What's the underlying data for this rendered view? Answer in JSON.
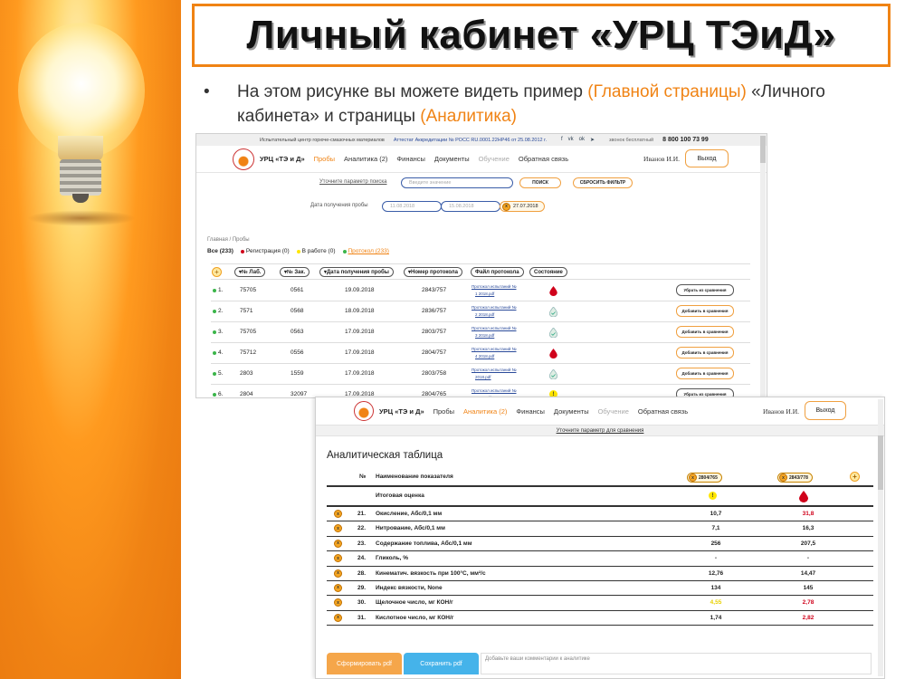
{
  "slide": {
    "title": "Личный кабинет «УРЦ ТЭиД»",
    "bullet_marker": "•",
    "bullet_parts": [
      "На этом рисунке вы можете видеть пример ",
      "(Главной страницы)",
      " «Личного кабинета» и страницы ",
      "(Аналитика)"
    ]
  },
  "colors": {
    "accent": "#f08314",
    "link": "#2a4a9a",
    "red": "#d0021b",
    "green": "#3bb54a"
  },
  "shot1": {
    "topbar": {
      "org": "Испытательный центр горюче-смазочных материалов",
      "accreditation": "Аттестат Аккредитации № РОСС RU.0001.22НР46 от 25.08.2012 г.",
      "social": [
        "f",
        "vk",
        "ok",
        "tg"
      ],
      "phone_label": "звонок бесплатный",
      "phone": "8 800 100 73 99"
    },
    "nav": {
      "brand": "УРЦ «ТЭ и Д»",
      "items": [
        {
          "label": "Пробы",
          "state": "active"
        },
        {
          "label": "Аналитика (2)",
          "state": "normal"
        },
        {
          "label": "Финансы",
          "state": "normal"
        },
        {
          "label": "Документы",
          "state": "normal"
        },
        {
          "label": "Обучение",
          "state": "muted"
        },
        {
          "label": "Обратная связь",
          "state": "normal"
        }
      ],
      "user": "Иванов И.И.",
      "exit": "Выход"
    },
    "filters": {
      "search_label": "Уточните параметр поиска",
      "search_placeholder": "Введите значение",
      "search_btn": "ПОИСК",
      "reset_btn": "СБРОСИТЬ ФИЛЬТР",
      "date_label": "Дата получения пробы",
      "date_from": "11.08.2018",
      "date_to": "15.08.2018",
      "chip_x": "x",
      "chip_date": "27.07.2018"
    },
    "breadcrumb": "Главная / Пробы",
    "counts": {
      "all": "Все (233)",
      "reg": "Регистрация (0)",
      "work": "В работе (0)",
      "protocol": "Протокол (233)"
    },
    "columns": [
      "№ Лаб.",
      "№ Зак.",
      "Дата получения пробы",
      "Номер протокола",
      "Файл протокола",
      "Состояние"
    ],
    "rows": [
      {
        "n": "1.",
        "lab": "75705",
        "order": "0561",
        "date": "19.09.2018",
        "protocol": "2843/757",
        "file1": "Протокол испытаний №",
        "file2": "1 2018.pdf",
        "status": "red",
        "action": "Убрать из сравнения",
        "kind": "rem"
      },
      {
        "n": "2.",
        "lab": "7571",
        "order": "0568",
        "date": "18.09.2018",
        "protocol": "2836/757",
        "file1": "Протокол испытаний №",
        "file2": "2 2018.pdf",
        "status": "ok",
        "action": "Добавить в сравнения",
        "kind": "add"
      },
      {
        "n": "3.",
        "lab": "75705",
        "order": "0563",
        "date": "17.09.2018",
        "protocol": "2803/757",
        "file1": "Протокол испытаний №",
        "file2": "3 2018.pdf",
        "status": "ok",
        "action": "Добавить в сравнения",
        "kind": "add"
      },
      {
        "n": "4.",
        "lab": "75712",
        "order": "0556",
        "date": "17.09.2018",
        "protocol": "2804/757",
        "file1": "Протокол испытаний №",
        "file2": "4 2018.pdf",
        "status": "red",
        "action": "Добавить в сравнения",
        "kind": "add"
      },
      {
        "n": "5.",
        "lab": "2803",
        "order": "1559",
        "date": "17.09.2018",
        "protocol": "2803/758",
        "file1": "Протокол испытаний №",
        "file2": "2018.pdf",
        "status": "ok",
        "action": "Добавить в сравнения",
        "kind": "add"
      },
      {
        "n": "6.",
        "lab": "2804",
        "order": "32097",
        "date": "17.09.2018",
        "protocol": "2804/765",
        "file1": "Протокол испытаний №",
        "file2": "2018.pdf",
        "status": "warn",
        "action": "Убрать из сравнения",
        "kind": "rem"
      }
    ]
  },
  "shot2": {
    "nav": {
      "brand": "УРЦ «ТЭ и Д»",
      "items": [
        {
          "label": "Пробы",
          "state": "normal"
        },
        {
          "label": "Аналитика (2)",
          "state": "active"
        },
        {
          "label": "Финансы",
          "state": "normal"
        },
        {
          "label": "Документы",
          "state": "normal"
        },
        {
          "label": "Обучение",
          "state": "muted"
        },
        {
          "label": "Обратная связь",
          "state": "normal"
        }
      ],
      "user": "Иванов И.И.",
      "exit": "Выход"
    },
    "subbar": "Уточните параметр для сравнения",
    "title": "Аналитическая таблица",
    "header": {
      "num": "№",
      "name": "Наименование показателя",
      "tag1": "2804/765",
      "tag2": "2843/778"
    },
    "summary_label": "Итоговая оценка",
    "rows": [
      {
        "n": "21.",
        "name": "Окисление, Абс/0,1 мм",
        "v1": "10,7",
        "v2": "31,8",
        "c1": "",
        "c2": "red"
      },
      {
        "n": "22.",
        "name": "Нитрование, Абс/0,1 мм",
        "v1": "7,1",
        "v2": "16,3",
        "c1": "",
        "c2": ""
      },
      {
        "n": "23.",
        "name": "Содержание топлива, Абс/0,1 мм",
        "v1": "256",
        "v2": "207,5",
        "c1": "",
        "c2": ""
      },
      {
        "n": "24.",
        "name": "Гликоль, %",
        "v1": "-",
        "v2": "-",
        "c1": "",
        "c2": ""
      },
      {
        "n": "28.",
        "name": "Кинематич. вязкость при 100°С, мм²/с",
        "v1": "12,76",
        "v2": "14,47",
        "c1": "",
        "c2": ""
      },
      {
        "n": "29.",
        "name": "Индекс вязкости, None",
        "v1": "134",
        "v2": "145",
        "c1": "",
        "c2": ""
      },
      {
        "n": "30.",
        "name": "Щелочное число, мг КОН/г",
        "v1": "4,55",
        "v2": "2,78",
        "c1": "yellowtxt",
        "c2": "red"
      },
      {
        "n": "31.",
        "name": "Кислотное число, мг КОН/г",
        "v1": "1,74",
        "v2": "2,82",
        "c1": "",
        "c2": "red"
      }
    ],
    "row_x": "x",
    "pdf_btn": "Сформировать pdf",
    "save_btn": "Сохранить pdf",
    "comment_placeholder": "Добавьте ваши комментарии к аналитике"
  }
}
